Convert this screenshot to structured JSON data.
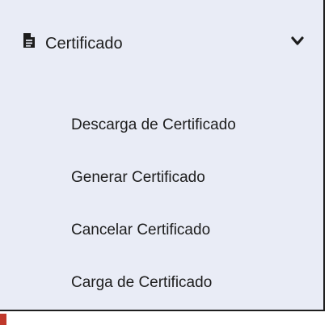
{
  "menu": {
    "header": {
      "label": "Certificado",
      "icon": "document-icon",
      "toggle_icon": "chevron-down-icon"
    },
    "items": [
      {
        "label": "Descarga de Certificado"
      },
      {
        "label": "Generar Certificado"
      },
      {
        "label": "Cancelar Certificado"
      },
      {
        "label": "Carga de Certificado"
      }
    ]
  },
  "colors": {
    "panel_background": "#e9ecf6",
    "text": "#1d1d1d",
    "border": "#1f1f1f"
  }
}
